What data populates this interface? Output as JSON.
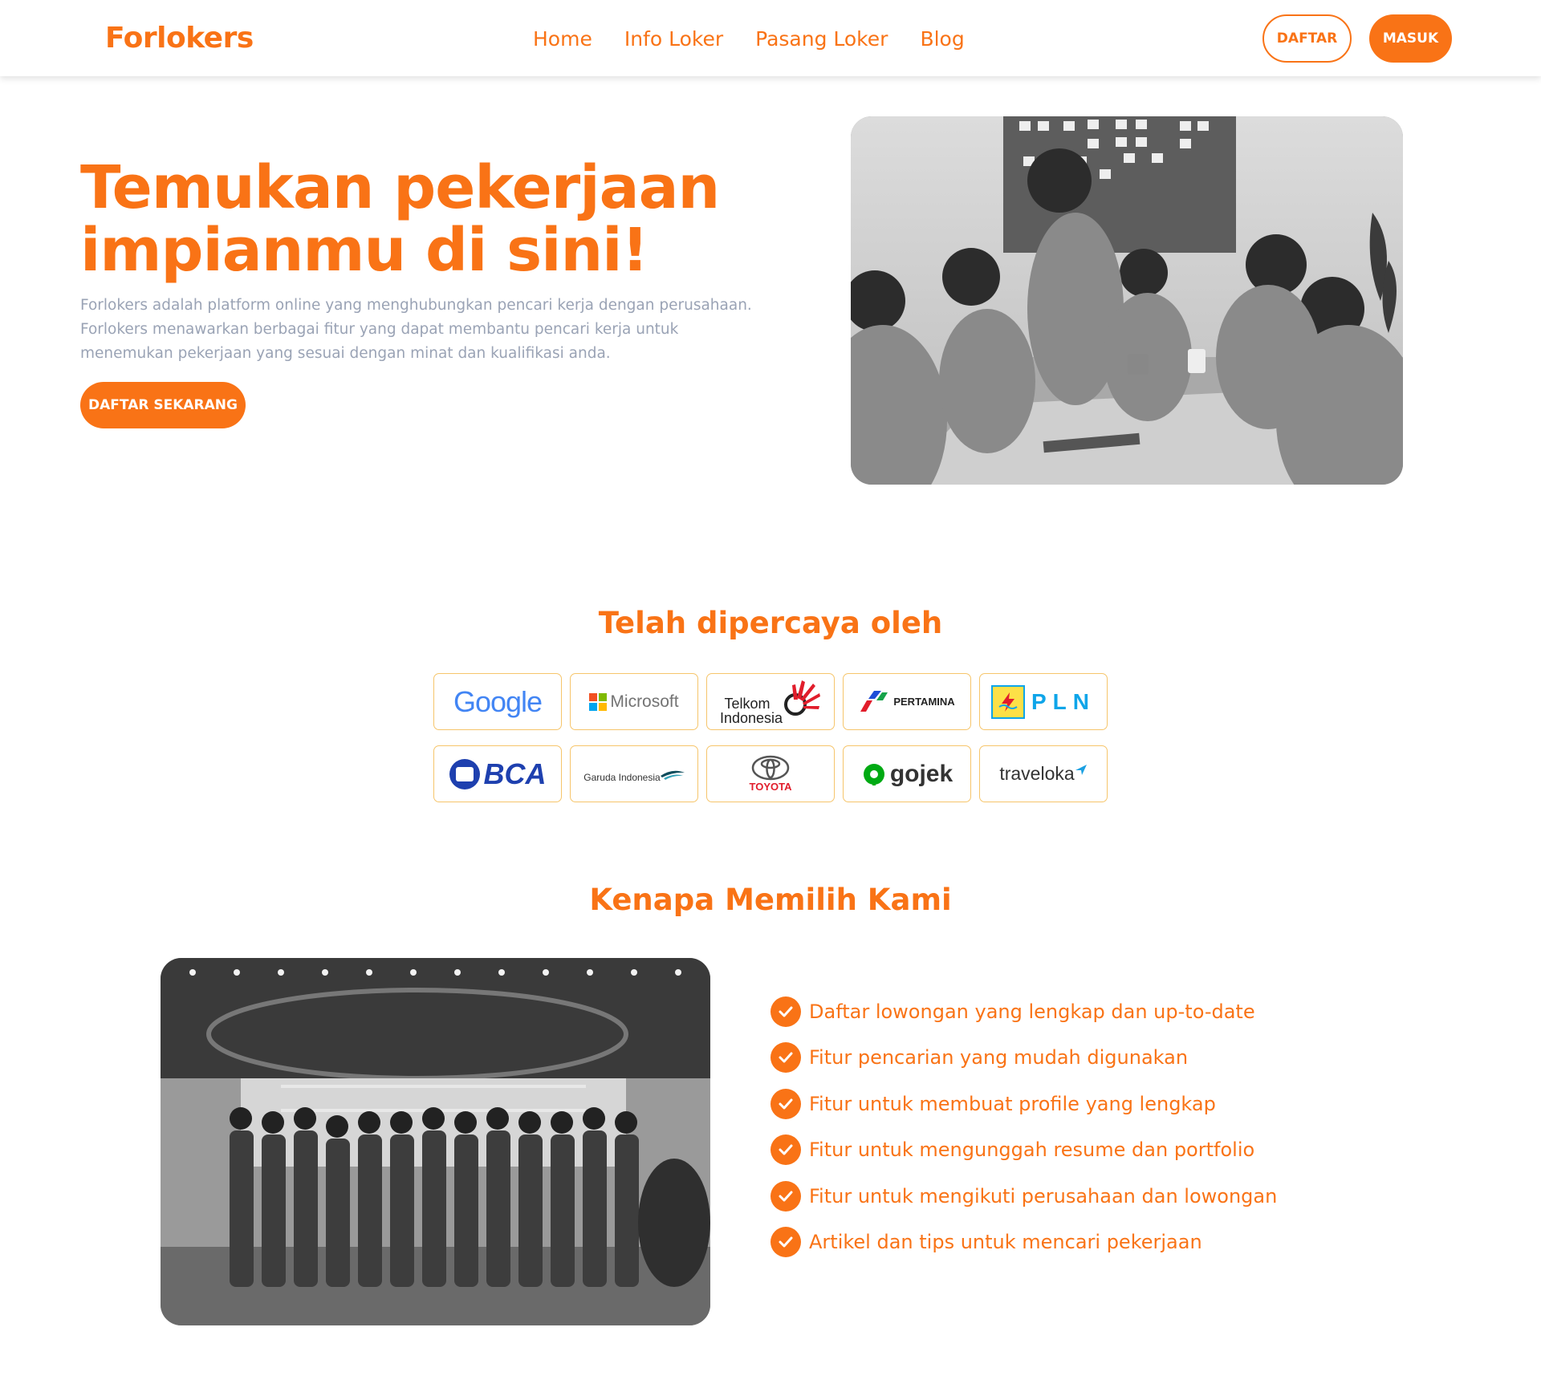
{
  "navbar": {
    "brand": "Forlokers",
    "links": [
      "Home",
      "Info Loker",
      "Pasang Loker",
      "Blog"
    ],
    "daftar_label": "DAFTAR",
    "masuk_label": "MASUK"
  },
  "hero": {
    "title_line1": "Temukan pekerjaan",
    "title_line2": "impianmu di sini!",
    "description": "Forlokers adalah platform online yang menghubungkan pencari kerja dengan perusahaan. Forlokers menawarkan berbagai fitur yang dapat membantu pencari kerja untuk menemukan pekerjaan yang sesuai dengan minat dan kualifikasi anda.",
    "cta_label": "DAFTAR SEKARANG",
    "image": "team-meeting-handshake-photo"
  },
  "trusted": {
    "title": "Telah dipercaya oleh",
    "logos": [
      {
        "name": "google-logo",
        "text": "Google"
      },
      {
        "name": "microsoft-logo",
        "text": "Microsoft"
      },
      {
        "name": "telkom-indonesia-logo",
        "text": "Telkom Indonesia"
      },
      {
        "name": "pertamina-logo",
        "text": "PERTAMINA"
      },
      {
        "name": "pln-logo",
        "text": "PLN"
      },
      {
        "name": "bca-logo",
        "text": "BCA"
      },
      {
        "name": "garuda-indonesia-logo",
        "text": "Garuda Indonesia"
      },
      {
        "name": "toyota-logo",
        "text": "TOYOTA"
      },
      {
        "name": "gojek-logo",
        "text": "gojek"
      },
      {
        "name": "traveloka-logo",
        "text": "traveloka"
      }
    ]
  },
  "why": {
    "title": "Kenapa Memilih Kami",
    "image": "team-group-office-photo",
    "features": [
      "Daftar lowongan yang lengkap dan up-to-date",
      "Fitur pencarian yang mudah digunakan",
      "Fitur untuk membuat profile yang lengkap",
      "Fitur untuk mengunggah resume dan portfolio",
      "Fitur untuk mengikuti perusahaan dan lowongan",
      "Artikel dan tips untuk mencari pekerjaan"
    ]
  },
  "colors": {
    "accent": "#f97316",
    "muted_text": "#9aa3b5",
    "logo_border": "#f6c56b"
  }
}
